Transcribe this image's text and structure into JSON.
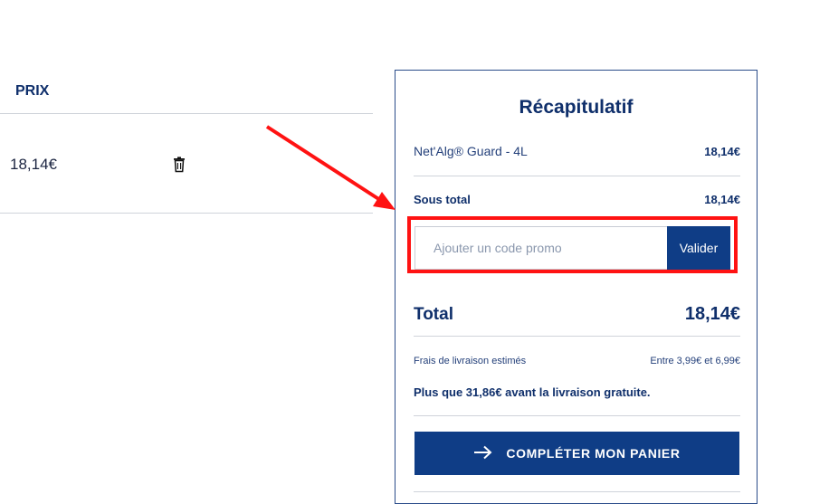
{
  "cart": {
    "price_header": "PRIX",
    "price_value": "18,14€"
  },
  "summary": {
    "title": "Récapitulatif",
    "item": {
      "name": "Net'Alg® Guard - 4L",
      "price": "18,14€"
    },
    "subtotal": {
      "label": "Sous total",
      "value": "18,14€"
    },
    "promo": {
      "placeholder": "Ajouter un code promo",
      "value": "",
      "button_label": "Valider"
    },
    "total": {
      "label": "Total",
      "value": "18,14€"
    },
    "shipping": {
      "label": "Frais de livraison estimés",
      "value": "Entre 3,99€ et 6,99€"
    },
    "free_shipping_notice": "Plus que 31,86€ avant la livraison gratuite.",
    "cta_label": "COMPLÉTER MON PANIER"
  },
  "icons": [
    "trash-icon",
    "arrow-right-icon"
  ],
  "colors": {
    "primary": "#0f3d86",
    "text": "#0f2f6b",
    "annotation": "#ff1212"
  }
}
